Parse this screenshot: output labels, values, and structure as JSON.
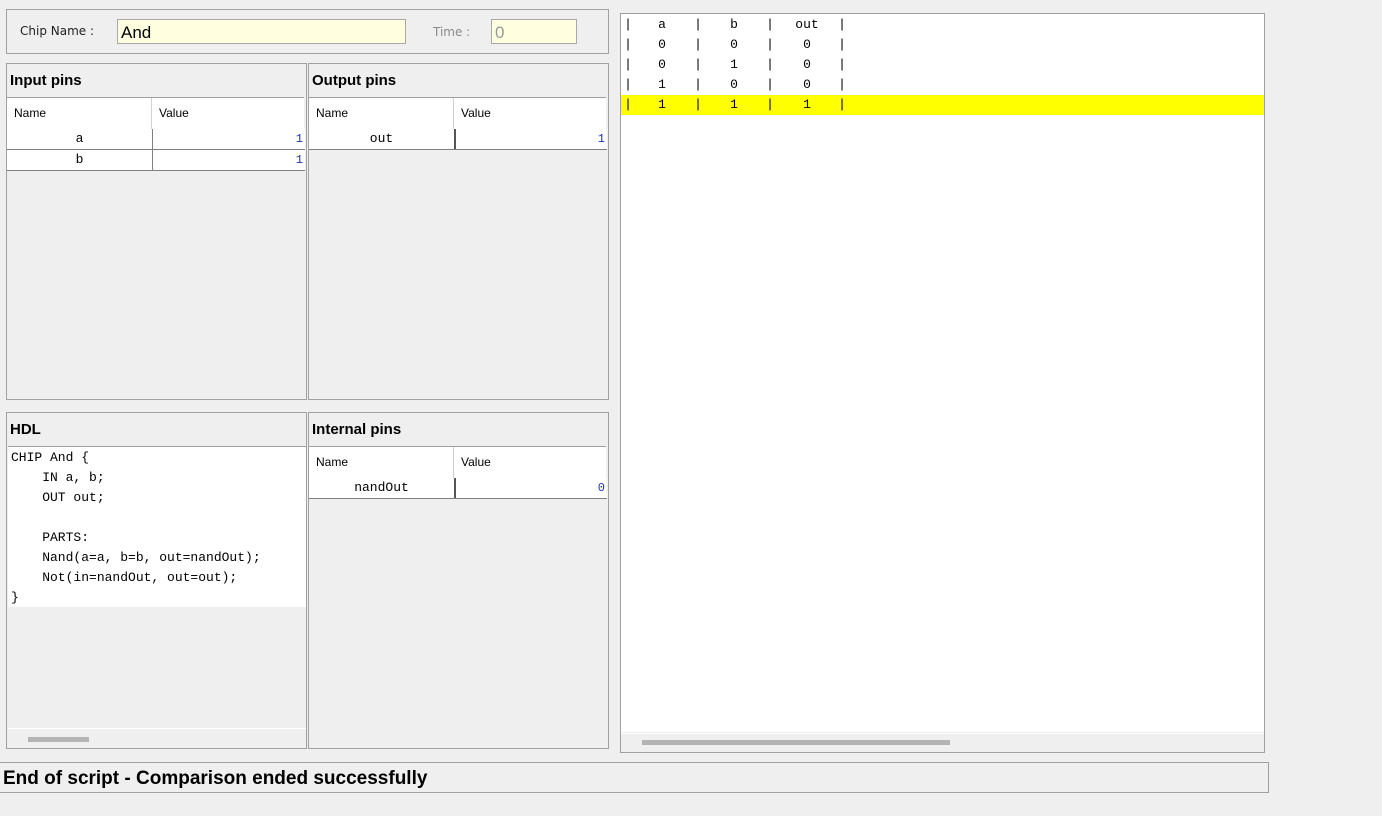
{
  "chip": {
    "name_label": "Chip Name :",
    "name_value": "And",
    "time_label": "Time :",
    "time_value": "0"
  },
  "input_pins": {
    "title": "Input pins",
    "columns": [
      "Name",
      "Value"
    ],
    "rows": [
      {
        "name": "a",
        "value": "1"
      },
      {
        "name": "b",
        "value": "1"
      }
    ]
  },
  "output_pins": {
    "title": "Output pins",
    "columns": [
      "Name",
      "Value"
    ],
    "rows": [
      {
        "name": "out",
        "value": "1"
      }
    ]
  },
  "hdl": {
    "title": "HDL",
    "lines": [
      "CHIP And {",
      "    IN a, b;",
      "    OUT out;",
      "",
      "    PARTS:",
      "    Nand(a=a, b=b, out=nandOut);",
      "    Not(in=nandOut, out=out);",
      "}"
    ]
  },
  "internal_pins": {
    "title": "Internal pins",
    "columns": [
      "Name",
      "Value"
    ],
    "rows": [
      {
        "name": "nandOut",
        "value": "0"
      }
    ]
  },
  "compare_output": {
    "separator": "|",
    "header": [
      "a",
      "b",
      "out"
    ],
    "rows": [
      [
        "0",
        "0",
        "0"
      ],
      [
        "0",
        "1",
        "0"
      ],
      [
        "1",
        "0",
        "0"
      ],
      [
        "1",
        "1",
        "1"
      ]
    ],
    "highlight_row_index": 3,
    "highlight_color": "#ffff00"
  },
  "status": {
    "message": "End of script - Comparison ended successfully"
  }
}
